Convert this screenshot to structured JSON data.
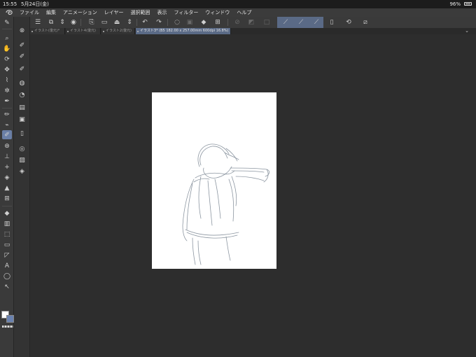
{
  "status": {
    "time": "15:55",
    "date": "5月24日(金)",
    "battery": "96%"
  },
  "menu": [
    "ファイル",
    "編集",
    "アニメーション",
    "レイヤー",
    "選択範囲",
    "表示",
    "フィルター",
    "ウィンドウ",
    "ヘルプ"
  ],
  "tabs": [
    {
      "label": "イラスト(復元)*",
      "active": false
    },
    {
      "label": "イラスト4(復元)",
      "active": false
    },
    {
      "label": "イラスト2(復元)",
      "active": false
    },
    {
      "label": "イラスト3* (B5 182.00 x 257.00mm 600dpi 16.8%)",
      "active": true
    }
  ],
  "colors": {
    "accent": "#6a7fa6",
    "main_color": "#ffffff",
    "sub_color": "#6a82b0",
    "sketch_stroke": "#7f8a96"
  },
  "left_tools": [
    "brush-icon",
    "zoom-icon",
    "hand-icon",
    "rotate-icon",
    "move-icon",
    "eyedropper-icon",
    "select-lasso-icon",
    "pen-icon",
    "pencil-icon",
    "marker-icon",
    "brush-active-icon",
    "airbrush-icon",
    "stamp-icon",
    "blend-icon",
    "eraser-icon",
    "fill-icon",
    "frame-icon",
    "fill-bucket-icon",
    "gradient-icon",
    "shape-icon",
    "ruler-icon",
    "figure-icon",
    "text-icon",
    "balloon-icon",
    "correction-icon"
  ],
  "sub_tools": [
    "close-icon",
    "dip-pen-icon",
    "g-pen-icon",
    "round-pen-icon",
    "pen-settings-icon",
    "water-icon",
    "layer-icon",
    "layer-mask-icon",
    "folder-icon",
    "material-icon",
    "image-icon",
    "layers-stack-icon"
  ]
}
